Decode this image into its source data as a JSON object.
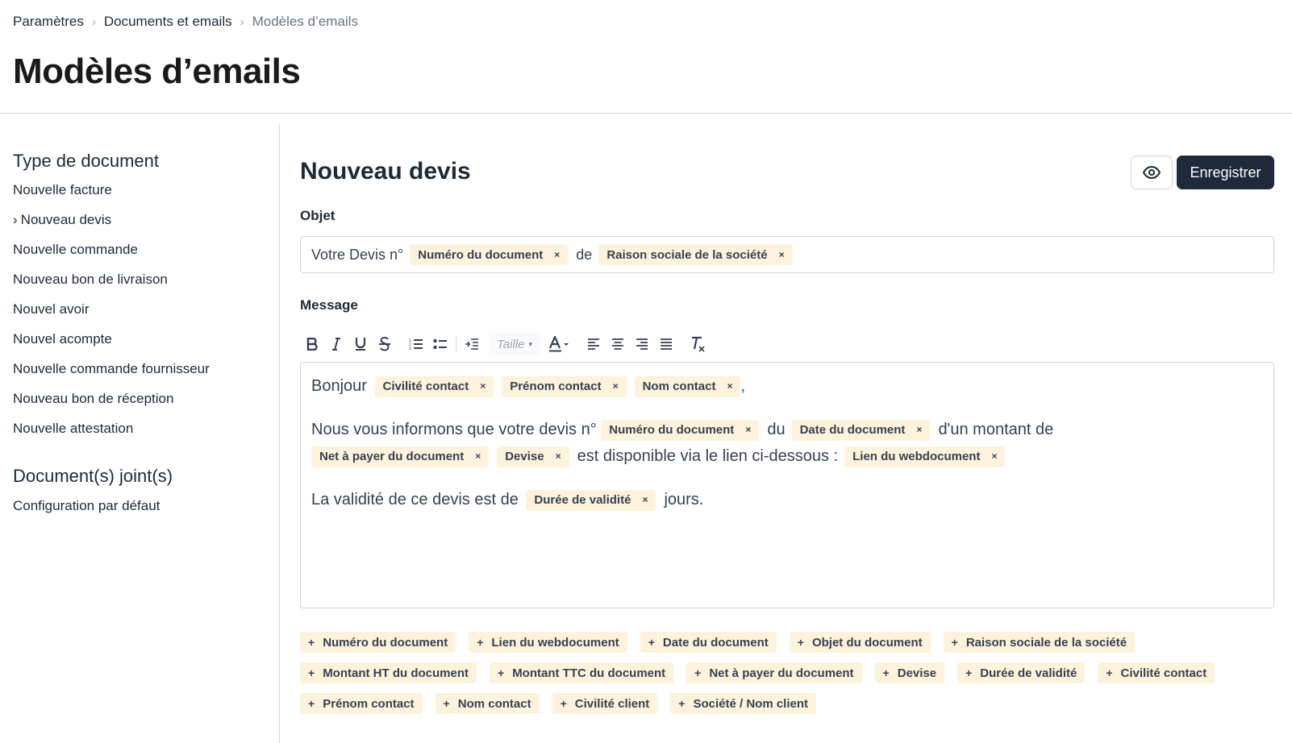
{
  "breadcrumb": [
    "Paramètres",
    "Documents et emails",
    "Modèles d’emails"
  ],
  "page_title": "Modèles d’emails",
  "sidebar": {
    "doc_type_heading": "Type de document",
    "doc_types": [
      "Nouvelle facture",
      "Nouveau devis",
      "Nouvelle commande",
      "Nouveau bon de livraison",
      "Nouvel avoir",
      "Nouvel acompte",
      "Nouvelle commande fournisseur",
      "Nouveau bon de réception",
      "Nouvelle attestation"
    ],
    "active_index": 1,
    "attachments_heading": "Document(s) joint(s)",
    "attachments": [
      "Configuration par défaut"
    ]
  },
  "main": {
    "title": "Nouveau devis",
    "save_label": "Enregistrer",
    "subject_label": "Objet",
    "subject": {
      "t1": "Votre Devis n°",
      "c1": "Numéro du document",
      "t2": "de",
      "c2": "Raison sociale de la société"
    },
    "message_label": "Message",
    "toolbar": {
      "size_label": "Taille"
    },
    "message": {
      "l1_text": "Bonjour",
      "l1_c1": "Civilité contact",
      "l1_c2": "Prénom contact",
      "l1_c3": "Nom contact",
      "l1_end": ",",
      "l2_t1": "Nous vous informons que votre devis n°",
      "l2_c1": "Numéro du document",
      "l2_t2": "du",
      "l2_c2": "Date du document",
      "l2_t3": "d'un montant de",
      "l3_c1": "Net à payer du document",
      "l3_c2": "Devise",
      "l3_t1": "est disponible via le lien ci-dessous :",
      "l3_c3": "Lien du webdocument",
      "l4_t1": "La validité de ce devis est de",
      "l4_c1": "Durée de validité",
      "l4_t2": "jours."
    },
    "variables": [
      "Numéro du document",
      "Lien du webdocument",
      "Date du document",
      "Objet du document",
      "Raison sociale de la société",
      "Montant HT du document",
      "Montant TTC du document",
      "Net à payer du document",
      "Devise",
      "Durée de validité",
      "Civilité contact",
      "Prénom contact",
      "Nom contact",
      "Civilité client",
      "Société / Nom client"
    ]
  },
  "icons": {
    "remove": "×",
    "add": "+",
    "breadcrumb_sep": "chevron-right-icon",
    "preview": "eye-icon"
  }
}
